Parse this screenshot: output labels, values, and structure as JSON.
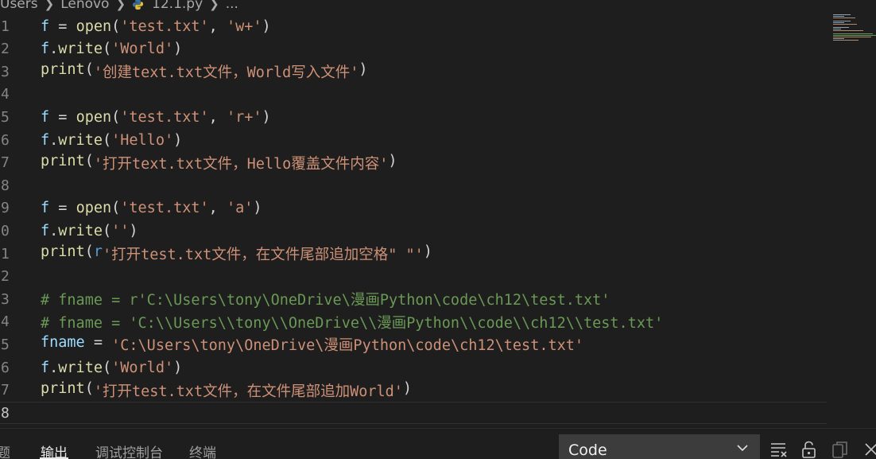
{
  "breadcrumb": {
    "items": [
      "Users",
      "Lenovo"
    ],
    "file_label": "12.1.py",
    "more": "..."
  },
  "editor": {
    "lines": [
      {
        "num": "1",
        "tokens": [
          [
            "var",
            "f"
          ],
          [
            "op",
            " = "
          ],
          [
            "fn",
            "open"
          ],
          [
            "op",
            "("
          ],
          [
            "str",
            "'test.txt'"
          ],
          [
            "op",
            ", "
          ],
          [
            "str",
            "'w+'"
          ],
          [
            "op",
            ")"
          ]
        ]
      },
      {
        "num": "2",
        "tokens": [
          [
            "var",
            "f"
          ],
          [
            "op",
            "."
          ],
          [
            "fn",
            "write"
          ],
          [
            "op",
            "("
          ],
          [
            "str",
            "'World'"
          ],
          [
            "op",
            ")"
          ]
        ]
      },
      {
        "num": "3",
        "tokens": [
          [
            "fn",
            "print"
          ],
          [
            "op",
            "("
          ],
          [
            "str",
            "'创建text.txt文件，World写入文件'"
          ],
          [
            "op",
            ")"
          ]
        ]
      },
      {
        "num": "4",
        "tokens": []
      },
      {
        "num": "5",
        "tokens": [
          [
            "var",
            "f"
          ],
          [
            "op",
            " = "
          ],
          [
            "fn",
            "open"
          ],
          [
            "op",
            "("
          ],
          [
            "str",
            "'test.txt'"
          ],
          [
            "op",
            ", "
          ],
          [
            "str",
            "'r+'"
          ],
          [
            "op",
            ")"
          ]
        ]
      },
      {
        "num": "6",
        "tokens": [
          [
            "var",
            "f"
          ],
          [
            "op",
            "."
          ],
          [
            "fn",
            "write"
          ],
          [
            "op",
            "("
          ],
          [
            "str",
            "'Hello'"
          ],
          [
            "op",
            ")"
          ]
        ]
      },
      {
        "num": "7",
        "tokens": [
          [
            "fn",
            "print"
          ],
          [
            "op",
            "("
          ],
          [
            "str",
            "'打开text.txt文件，Hello覆盖文件内容'"
          ],
          [
            "op",
            ")"
          ]
        ]
      },
      {
        "num": "8",
        "tokens": []
      },
      {
        "num": "9",
        "tokens": [
          [
            "var",
            "f"
          ],
          [
            "op",
            " = "
          ],
          [
            "fn",
            "open"
          ],
          [
            "op",
            "("
          ],
          [
            "str",
            "'test.txt'"
          ],
          [
            "op",
            ", "
          ],
          [
            "str",
            "'a'"
          ],
          [
            "op",
            ")"
          ]
        ]
      },
      {
        "num": "0",
        "tokens": [
          [
            "var",
            "f"
          ],
          [
            "op",
            "."
          ],
          [
            "fn",
            "write"
          ],
          [
            "op",
            "("
          ],
          [
            "str",
            "''"
          ],
          [
            "op",
            ")"
          ]
        ]
      },
      {
        "num": "1",
        "tokens": [
          [
            "fn",
            "print"
          ],
          [
            "op",
            "("
          ],
          [
            "pfx",
            "r"
          ],
          [
            "str",
            "'打开test.txt文件，在文件尾部追加空格\" \"'"
          ],
          [
            "op",
            ")"
          ]
        ]
      },
      {
        "num": "2",
        "tokens": []
      },
      {
        "num": "3",
        "tokens": [
          [
            "cmt",
            "# fname = r'C:\\Users\\tony\\OneDrive\\漫画Python\\code\\ch12\\test.txt'"
          ]
        ]
      },
      {
        "num": "4",
        "tokens": [
          [
            "cmt",
            "# fname = 'C:\\\\Users\\\\tony\\\\OneDrive\\\\漫画Python\\\\code\\\\ch12\\\\test.txt'"
          ]
        ]
      },
      {
        "num": "5",
        "tokens": [
          [
            "var",
            "fname"
          ],
          [
            "op",
            " = "
          ],
          [
            "str",
            "'C:\\Users\\tony\\OneDrive\\漫画Python\\code\\ch12\\test.txt'"
          ]
        ]
      },
      {
        "num": "6",
        "tokens": [
          [
            "var",
            "f"
          ],
          [
            "op",
            "."
          ],
          [
            "fn",
            "write"
          ],
          [
            "op",
            "("
          ],
          [
            "str",
            "'World'"
          ],
          [
            "op",
            ")"
          ]
        ]
      },
      {
        "num": "7",
        "tokens": [
          [
            "fn",
            "print"
          ],
          [
            "op",
            "("
          ],
          [
            "str",
            "'打开test.txt文件，在文件尾部追加World'"
          ],
          [
            "op",
            ")"
          ]
        ]
      },
      {
        "num": "8",
        "tokens": [],
        "current": true
      }
    ]
  },
  "panel": {
    "tabs": [
      "题",
      "输出",
      "调试控制台",
      "终端"
    ],
    "active_tab": "输出",
    "output_channel": "Code"
  },
  "colors": {
    "background": "#1e1e1e",
    "function": "#dcdcaa",
    "variable": "#9cdcfe",
    "string": "#ce9178",
    "comment": "#6a9955",
    "keyword": "#569cd6"
  },
  "icons": {
    "file_icon": "python-icon",
    "chevron": "chevron-down-icon",
    "panel_actions": [
      "clear-output-icon",
      "lock-icon",
      "copy-icon",
      "close-icon"
    ]
  }
}
